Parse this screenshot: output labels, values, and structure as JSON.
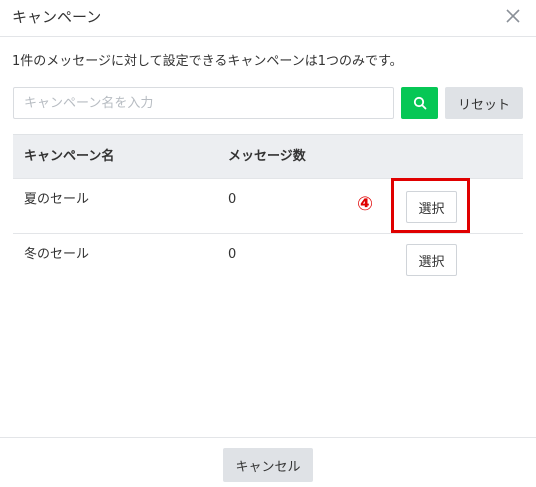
{
  "dialog": {
    "title": "キャンペーン",
    "close_icon": "close-icon",
    "description": "1件のメッセージに対して設定できるキャンペーンは1つのみです。"
  },
  "search": {
    "placeholder": "キャンペーン名を入力",
    "value": "",
    "button_icon": "search-icon",
    "button_color": "#06c755",
    "reset_label": "リセット"
  },
  "table": {
    "headers": [
      "キャンペーン名",
      "メッセージ数"
    ],
    "rows": [
      {
        "name": "夏のセール",
        "count": "0",
        "action": "選択"
      },
      {
        "name": "冬のセール",
        "count": "0",
        "action": "選択"
      }
    ]
  },
  "annotation": {
    "number": "④",
    "color": "#e00000"
  },
  "footer": {
    "cancel_label": "キャンセル"
  }
}
